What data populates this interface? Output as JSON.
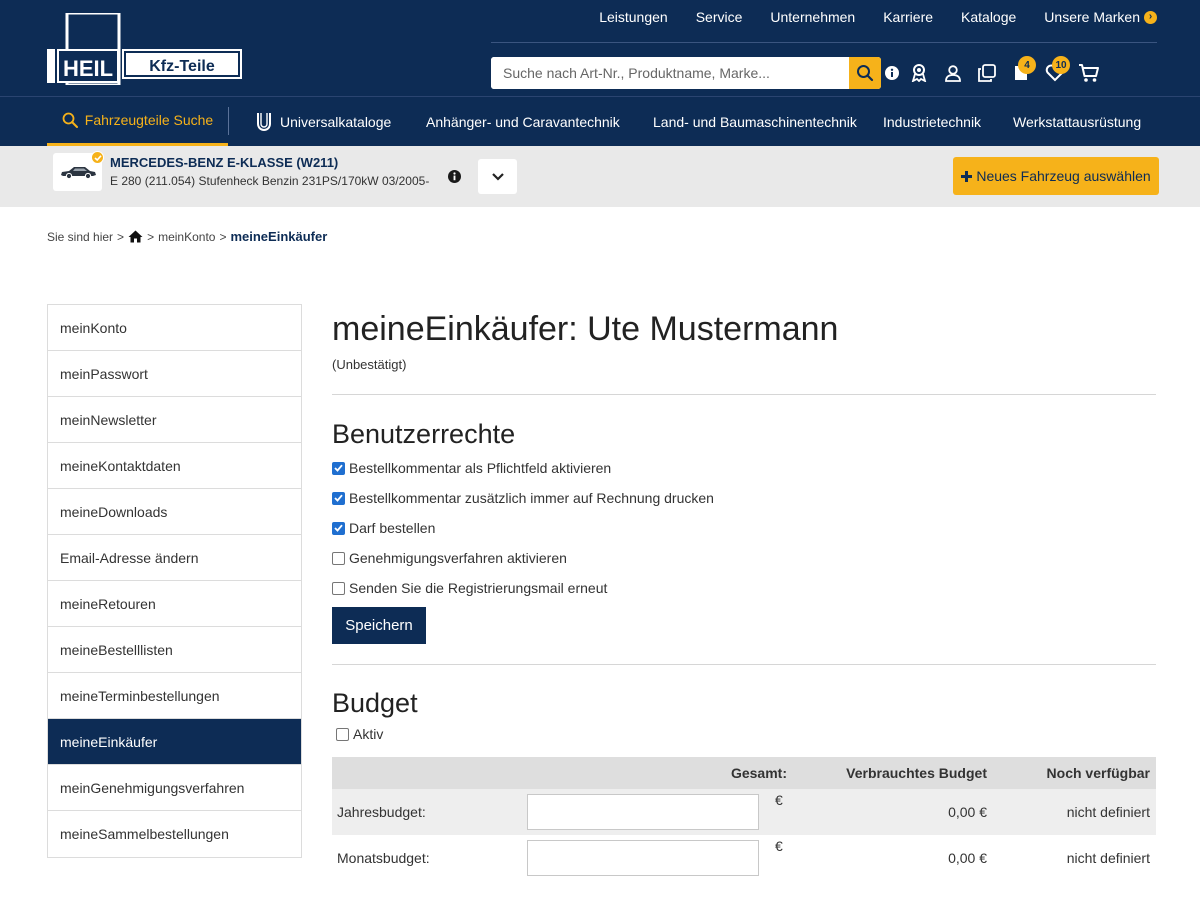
{
  "header": {
    "brand_left": "HEIL",
    "brand_right": "Kfz-Teile",
    "top_links": [
      "Leistungen",
      "Service",
      "Unternehmen",
      "Karriere",
      "Kataloge",
      "Unsere Marken"
    ],
    "search_placeholder": "Suche nach Art-Nr., Produktname, Marke...",
    "badge_orders": "4",
    "badge_wishlist": "10"
  },
  "nav": {
    "items": [
      "Fahrzeugteile Suche",
      "Universalkataloge",
      "Anhänger- und Caravantechnik",
      "Land- und Baumaschinentechnik",
      "Industrietechnik",
      "Werkstattausrüstung"
    ]
  },
  "vehicle": {
    "title": "MERCEDES-BENZ E-KLASSE (W211)",
    "subtitle": "E 280 (211.054) Stufenheck Benzin 231PS/170kW 03/2005-",
    "new_vehicle_label": "Neues Fahrzeug auswählen"
  },
  "breadcrumb": {
    "prefix": "Sie sind hier",
    "items": [
      "meinKonto",
      "meineEinkäufer"
    ]
  },
  "sidebar": {
    "items": [
      "meinKonto",
      "meinPasswort",
      "meinNewsletter",
      "meineKontaktdaten",
      "meineDownloads",
      "Email-Adresse ändern",
      "meineRetouren",
      "meineBestelllisten",
      "meineTerminbestellungen",
      "meineEinkäufer",
      "meinGenehmigungsverfahren",
      "meineSammelbestellungen"
    ],
    "active_index": 9
  },
  "main": {
    "title": "meineEinkäufer: Ute Mustermann",
    "status": "(Unbestätigt)",
    "rights_title": "Benutzerrechte",
    "rights": [
      {
        "label": "Bestellkommentar als Pflichtfeld aktivieren",
        "checked": true
      },
      {
        "label": "Bestellkommentar zusätzlich immer auf Rechnung drucken",
        "checked": true
      },
      {
        "label": "Darf bestellen",
        "checked": true
      },
      {
        "label": "Genehmigungsverfahren aktivieren",
        "checked": false
      },
      {
        "label": "Senden Sie die Registrierungsmail erneut",
        "checked": false
      }
    ],
    "save_label": "Speichern",
    "budget_title": "Budget",
    "budget_active_label": "Aktiv",
    "budget_active_checked": false,
    "budget_headers": {
      "total": "Gesamt:",
      "used": "Verbrauchtes Budget",
      "available": "Noch verfügbar"
    },
    "budget_rows": [
      {
        "label": "Jahresbudget:",
        "value": "",
        "currency": "€",
        "used": "0,00 €",
        "available": "nicht definiert"
      },
      {
        "label": "Monatsbudget:",
        "value": "",
        "currency": "€",
        "used": "0,00 €",
        "available": "nicht definiert"
      }
    ]
  },
  "colors": {
    "navy": "#0d2c55",
    "accent": "#f6b21a",
    "checkbox": "#1f6fd0"
  }
}
